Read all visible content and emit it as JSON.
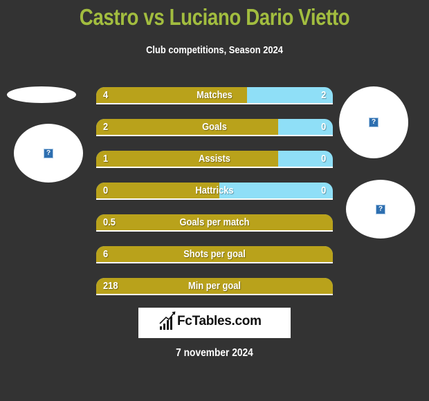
{
  "header": {
    "title": "Castro vs Luciano Dario Vietto",
    "subtitle": "Club competitions, Season 2024"
  },
  "colors": {
    "background": "#333333",
    "title": "#a2bd3f",
    "left_bar": "#b9a21b",
    "right_bar": "#8fdff7"
  },
  "players": {
    "left_placeholder_icon": "broken-image-icon",
    "right_placeholder_icon": "broken-image-icon"
  },
  "stats": [
    {
      "label": "Matches",
      "left": "4",
      "right": "2",
      "left_share": 0.637
    },
    {
      "label": "Goals",
      "left": "2",
      "right": "0",
      "left_share": 0.769
    },
    {
      "label": "Assists",
      "left": "1",
      "right": "0",
      "left_share": 0.769
    },
    {
      "label": "Hattricks",
      "left": "0",
      "right": "0",
      "left_share": 0.52
    },
    {
      "label": "Goals per match",
      "left": "0.5",
      "right": "",
      "left_share": 1
    },
    {
      "label": "Shots per goal",
      "left": "6",
      "right": "",
      "left_share": 1
    },
    {
      "label": "Min per goal",
      "left": "218",
      "right": "",
      "left_share": 1
    }
  ],
  "logo": {
    "text": "FcTables.com",
    "icon": "bar-chart-icon"
  },
  "footer": {
    "date": "7 november 2024"
  },
  "placeholder_glyph": "?"
}
